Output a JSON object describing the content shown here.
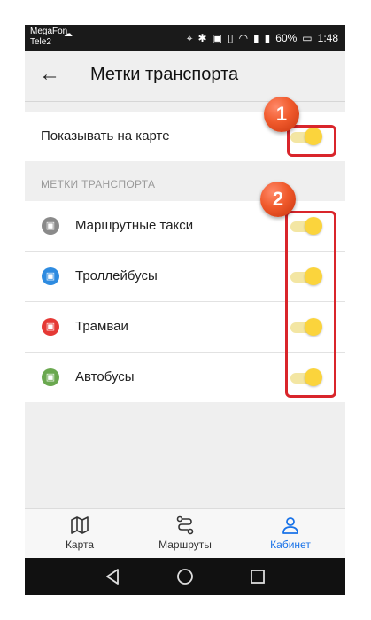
{
  "status_bar": {
    "carrier_1": "MegaFon",
    "carrier_2": "Tele2",
    "battery": "60%",
    "time": "1:48"
  },
  "app_bar": {
    "title": "Метки транспорта"
  },
  "show_on_map": {
    "label": "Показывать на карте",
    "enabled": true
  },
  "transport_section": {
    "header": "МЕТКИ ТРАНСПОРТА",
    "items": [
      {
        "label": "Маршрутные такси",
        "icon": "minibus-icon",
        "color": "#8a8a8a",
        "enabled": true
      },
      {
        "label": "Троллейбусы",
        "icon": "trolleybus-icon",
        "color": "#2e8be0",
        "enabled": true
      },
      {
        "label": "Трамваи",
        "icon": "tram-icon",
        "color": "#e53935",
        "enabled": true
      },
      {
        "label": "Автобусы",
        "icon": "bus-icon",
        "color": "#6aa84f",
        "enabled": true
      }
    ]
  },
  "annotations": {
    "badge_1": "1",
    "badge_2": "2",
    "highlight_color": "#d9252b"
  },
  "bottom_nav": {
    "items": [
      {
        "label": "Карта",
        "icon": "map-icon"
      },
      {
        "label": "Маршруты",
        "icon": "route-icon"
      },
      {
        "label": "Кабинет",
        "icon": "profile-icon",
        "active": true
      }
    ],
    "active_color": "#1a73e8"
  },
  "toggle_colors": {
    "knob": "#fbd43c",
    "track": "#f3e6a3"
  }
}
